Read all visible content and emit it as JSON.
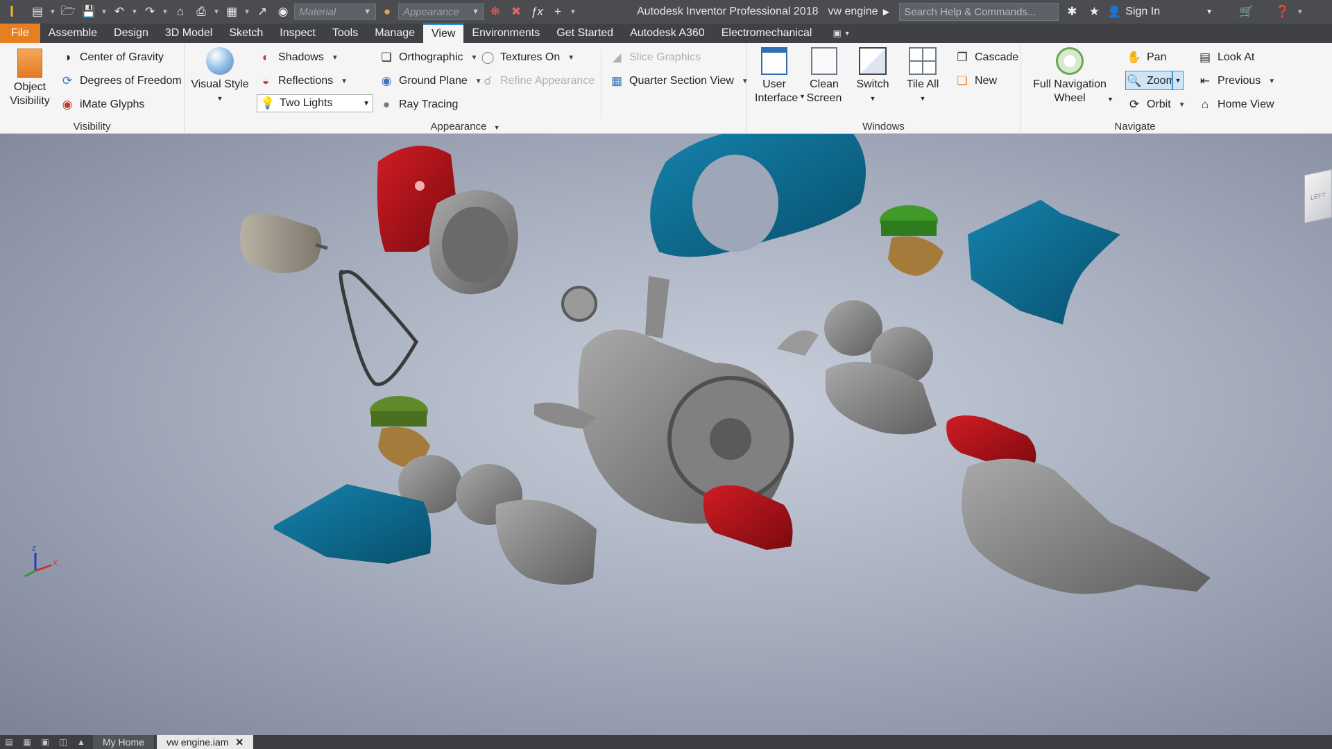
{
  "window": {
    "app_title": "Autodesk Inventor Professional 2018",
    "document_title": "vw engine",
    "logo": "I"
  },
  "quick_access": {
    "material_placeholder": "Material",
    "appearance_placeholder": "Appearance"
  },
  "search": {
    "placeholder": "Search Help & Commands..."
  },
  "account": {
    "sign_in": "Sign In"
  },
  "tabs": [
    {
      "label": "File"
    },
    {
      "label": "Assemble"
    },
    {
      "label": "Design"
    },
    {
      "label": "3D Model"
    },
    {
      "label": "Sketch"
    },
    {
      "label": "Inspect"
    },
    {
      "label": "Tools"
    },
    {
      "label": "Manage"
    },
    {
      "label": "View"
    },
    {
      "label": "Environments"
    },
    {
      "label": "Get Started"
    },
    {
      "label": "Autodesk A360"
    },
    {
      "label": "Electromechanical"
    }
  ],
  "ribbon": {
    "visibility": {
      "title": "Visibility",
      "object_visibility_1": "Object",
      "object_visibility_2": "Visibility",
      "center_of_gravity": "Center of Gravity",
      "degrees_of_freedom": "Degrees of Freedom",
      "imate_glyphs": "iMate Glyphs"
    },
    "appearance": {
      "title": "Appearance",
      "visual_style": "Visual Style",
      "shadows": "Shadows",
      "reflections": "Reflections",
      "lighting": "Two Lights",
      "orthographic": "Orthographic",
      "ground_plane": "Ground Plane",
      "ray_tracing": "Ray Tracing",
      "textures_on": "Textures On",
      "refine_appearance": "Refine Appearance",
      "slice_graphics": "Slice Graphics",
      "quarter_section_view": "Quarter Section View"
    },
    "windows": {
      "title": "Windows",
      "user_interface_1": "User",
      "user_interface_2": "Interface",
      "clean_screen_1": "Clean",
      "clean_screen_2": "Screen",
      "switch": "Switch",
      "tile_all": "Tile All",
      "cascade": "Cascade",
      "new": "New"
    },
    "navigate": {
      "title": "Navigate",
      "full_nav_wheel_1": "Full Navigation",
      "full_nav_wheel_2": "Wheel",
      "pan": "Pan",
      "zoom": "Zoom",
      "orbit": "Orbit",
      "look_at": "Look At",
      "previous": "Previous",
      "home_view": "Home View"
    }
  },
  "viewcube": {
    "face": "LEFT"
  },
  "axis_triad": {
    "z": "Z",
    "x": "X"
  },
  "document_tabs": [
    {
      "label": "My Home",
      "active": false
    },
    {
      "label": "vw engine.iam",
      "active": true
    }
  ],
  "colors": {
    "file_tab": "#e57f22",
    "active_tab_accent": "#2e90d1",
    "title_bar": "#4a4c50",
    "part_red": "#b8121a",
    "part_blue": "#0d6b8f",
    "part_green": "#3f9a2a",
    "part_grey": "#8c8c8c"
  }
}
